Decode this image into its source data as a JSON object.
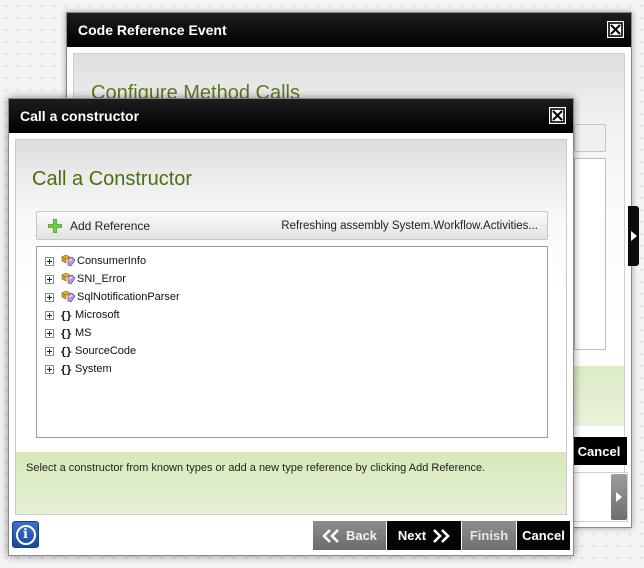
{
  "back_dialog": {
    "title": "Code Reference Event",
    "heading": "Configure Method Calls",
    "cancel_label": "Cancel"
  },
  "front_dialog": {
    "title": "Call a constructor",
    "heading": "Call a Constructor",
    "toolbar": {
      "add_reference_label": "Add Reference",
      "status_text": "Refreshing assembly System.Workflow.Activities..."
    },
    "tree": {
      "items": [
        {
          "label": "ConsumerInfo",
          "icon": "type-icon"
        },
        {
          "label": "SNI_Error",
          "icon": "type-icon"
        },
        {
          "label": "SqlNotificationParser",
          "icon": "type-icon"
        },
        {
          "label": "Microsoft",
          "icon": "namespace-icon"
        },
        {
          "label": "MS",
          "icon": "namespace-icon"
        },
        {
          "label": "SourceCode",
          "icon": "namespace-icon"
        },
        {
          "label": "System",
          "icon": "namespace-icon"
        }
      ]
    },
    "message": "Select a constructor from known types or add a new type reference by clicking Add Reference.",
    "footer": {
      "info_icon": "i",
      "back_label": "Back",
      "next_label": "Next",
      "finish_label": "Finish",
      "cancel_label": "Cancel"
    }
  },
  "colors": {
    "heading_green": "#4a6e14",
    "message_green": "#d6e8b9",
    "titlebar": "#000000",
    "info_blue": "#1a4aa0"
  }
}
